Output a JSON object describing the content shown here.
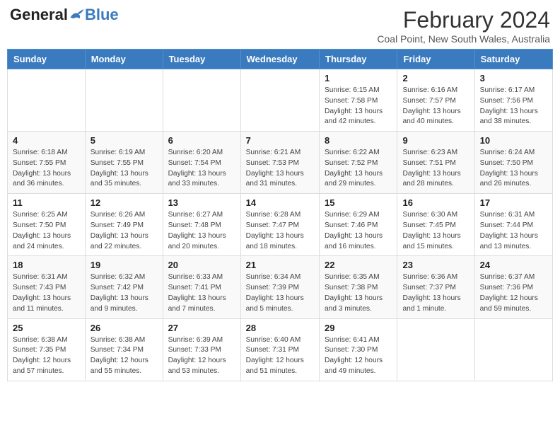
{
  "logo": {
    "general": "General",
    "blue": "Blue"
  },
  "header": {
    "title": "February 2024",
    "subtitle": "Coal Point, New South Wales, Australia"
  },
  "weekdays": [
    "Sunday",
    "Monday",
    "Tuesday",
    "Wednesday",
    "Thursday",
    "Friday",
    "Saturday"
  ],
  "weeks": [
    [
      {
        "day": "",
        "info": ""
      },
      {
        "day": "",
        "info": ""
      },
      {
        "day": "",
        "info": ""
      },
      {
        "day": "",
        "info": ""
      },
      {
        "day": "1",
        "info": "Sunrise: 6:15 AM\nSunset: 7:58 PM\nDaylight: 13 hours and 42 minutes."
      },
      {
        "day": "2",
        "info": "Sunrise: 6:16 AM\nSunset: 7:57 PM\nDaylight: 13 hours and 40 minutes."
      },
      {
        "day": "3",
        "info": "Sunrise: 6:17 AM\nSunset: 7:56 PM\nDaylight: 13 hours and 38 minutes."
      }
    ],
    [
      {
        "day": "4",
        "info": "Sunrise: 6:18 AM\nSunset: 7:55 PM\nDaylight: 13 hours and 36 minutes."
      },
      {
        "day": "5",
        "info": "Sunrise: 6:19 AM\nSunset: 7:55 PM\nDaylight: 13 hours and 35 minutes."
      },
      {
        "day": "6",
        "info": "Sunrise: 6:20 AM\nSunset: 7:54 PM\nDaylight: 13 hours and 33 minutes."
      },
      {
        "day": "7",
        "info": "Sunrise: 6:21 AM\nSunset: 7:53 PM\nDaylight: 13 hours and 31 minutes."
      },
      {
        "day": "8",
        "info": "Sunrise: 6:22 AM\nSunset: 7:52 PM\nDaylight: 13 hours and 29 minutes."
      },
      {
        "day": "9",
        "info": "Sunrise: 6:23 AM\nSunset: 7:51 PM\nDaylight: 13 hours and 28 minutes."
      },
      {
        "day": "10",
        "info": "Sunrise: 6:24 AM\nSunset: 7:50 PM\nDaylight: 13 hours and 26 minutes."
      }
    ],
    [
      {
        "day": "11",
        "info": "Sunrise: 6:25 AM\nSunset: 7:50 PM\nDaylight: 13 hours and 24 minutes."
      },
      {
        "day": "12",
        "info": "Sunrise: 6:26 AM\nSunset: 7:49 PM\nDaylight: 13 hours and 22 minutes."
      },
      {
        "day": "13",
        "info": "Sunrise: 6:27 AM\nSunset: 7:48 PM\nDaylight: 13 hours and 20 minutes."
      },
      {
        "day": "14",
        "info": "Sunrise: 6:28 AM\nSunset: 7:47 PM\nDaylight: 13 hours and 18 minutes."
      },
      {
        "day": "15",
        "info": "Sunrise: 6:29 AM\nSunset: 7:46 PM\nDaylight: 13 hours and 16 minutes."
      },
      {
        "day": "16",
        "info": "Sunrise: 6:30 AM\nSunset: 7:45 PM\nDaylight: 13 hours and 15 minutes."
      },
      {
        "day": "17",
        "info": "Sunrise: 6:31 AM\nSunset: 7:44 PM\nDaylight: 13 hours and 13 minutes."
      }
    ],
    [
      {
        "day": "18",
        "info": "Sunrise: 6:31 AM\nSunset: 7:43 PM\nDaylight: 13 hours and 11 minutes."
      },
      {
        "day": "19",
        "info": "Sunrise: 6:32 AM\nSunset: 7:42 PM\nDaylight: 13 hours and 9 minutes."
      },
      {
        "day": "20",
        "info": "Sunrise: 6:33 AM\nSunset: 7:41 PM\nDaylight: 13 hours and 7 minutes."
      },
      {
        "day": "21",
        "info": "Sunrise: 6:34 AM\nSunset: 7:39 PM\nDaylight: 13 hours and 5 minutes."
      },
      {
        "day": "22",
        "info": "Sunrise: 6:35 AM\nSunset: 7:38 PM\nDaylight: 13 hours and 3 minutes."
      },
      {
        "day": "23",
        "info": "Sunrise: 6:36 AM\nSunset: 7:37 PM\nDaylight: 13 hours and 1 minute."
      },
      {
        "day": "24",
        "info": "Sunrise: 6:37 AM\nSunset: 7:36 PM\nDaylight: 12 hours and 59 minutes."
      }
    ],
    [
      {
        "day": "25",
        "info": "Sunrise: 6:38 AM\nSunset: 7:35 PM\nDaylight: 12 hours and 57 minutes."
      },
      {
        "day": "26",
        "info": "Sunrise: 6:38 AM\nSunset: 7:34 PM\nDaylight: 12 hours and 55 minutes."
      },
      {
        "day": "27",
        "info": "Sunrise: 6:39 AM\nSunset: 7:33 PM\nDaylight: 12 hours and 53 minutes."
      },
      {
        "day": "28",
        "info": "Sunrise: 6:40 AM\nSunset: 7:31 PM\nDaylight: 12 hours and 51 minutes."
      },
      {
        "day": "29",
        "info": "Sunrise: 6:41 AM\nSunset: 7:30 PM\nDaylight: 12 hours and 49 minutes."
      },
      {
        "day": "",
        "info": ""
      },
      {
        "day": "",
        "info": ""
      }
    ]
  ]
}
